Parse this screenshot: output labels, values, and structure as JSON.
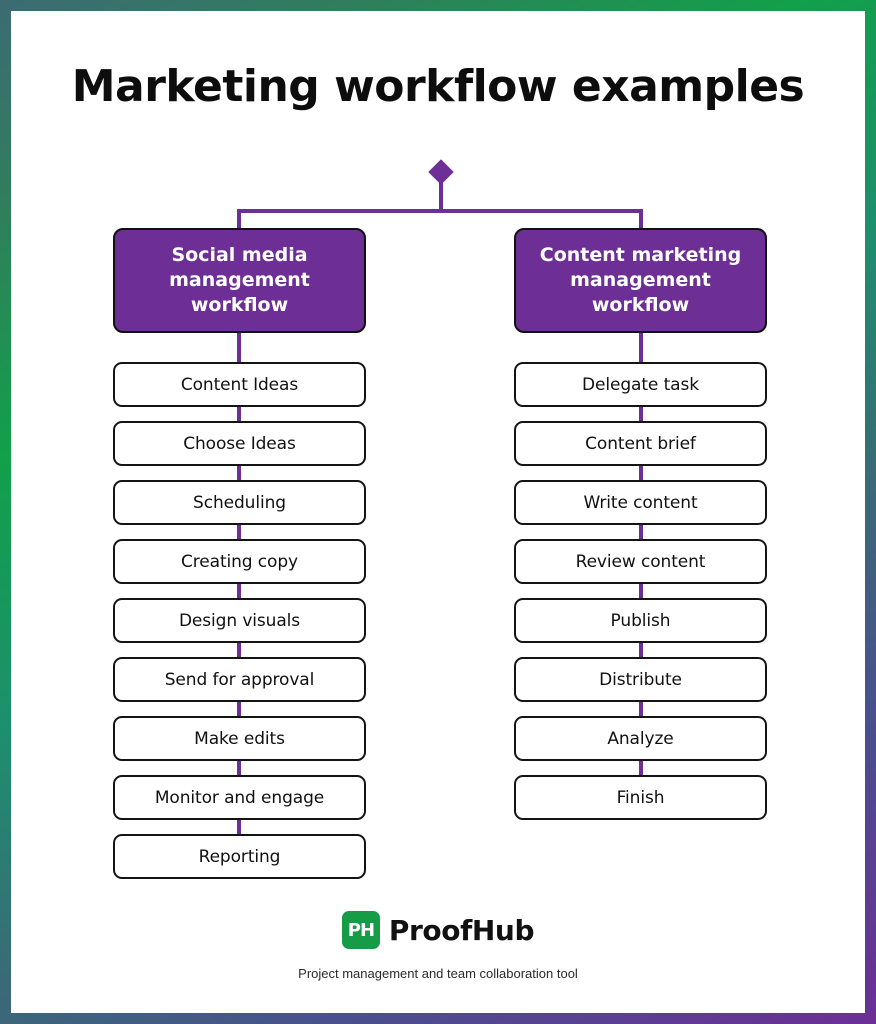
{
  "page": {
    "title": "Marketing workflow examples",
    "background_color": "#ffffff",
    "frame_gradient_colors": [
      "#3c6b73",
      "#12a04a",
      "#396b76",
      "#6c2f96"
    ]
  },
  "diagram": {
    "type": "flowchart",
    "root_node": "diamond-connector",
    "accent_color": "#6d2f96",
    "box_border_color": "#141414",
    "columns": [
      {
        "id": "social-media-management-workflow",
        "header": "Social media management workflow",
        "header_text_color": "#ffffff",
        "header_fill": "#6d2f96",
        "steps": [
          "Content Ideas",
          "Choose Ideas",
          "Scheduling",
          "Creating copy",
          "Design visuals",
          "Send for approval",
          "Make edits",
          "Monitor and engage",
          "Reporting"
        ]
      },
      {
        "id": "content-marketing-management-workflow",
        "header": "Content marketing management workflow",
        "header_text_color": "#ffffff",
        "header_fill": "#6d2f96",
        "steps": [
          "Delegate task",
          "Content brief",
          "Write content",
          "Review content",
          "Publish",
          "Distribute",
          "Analyze",
          "Finish"
        ]
      }
    ]
  },
  "brand": {
    "logo_text": "PH",
    "logo_color": "#169b47",
    "name": "ProofHub",
    "tagline": "Project management and team collaboration tool"
  }
}
